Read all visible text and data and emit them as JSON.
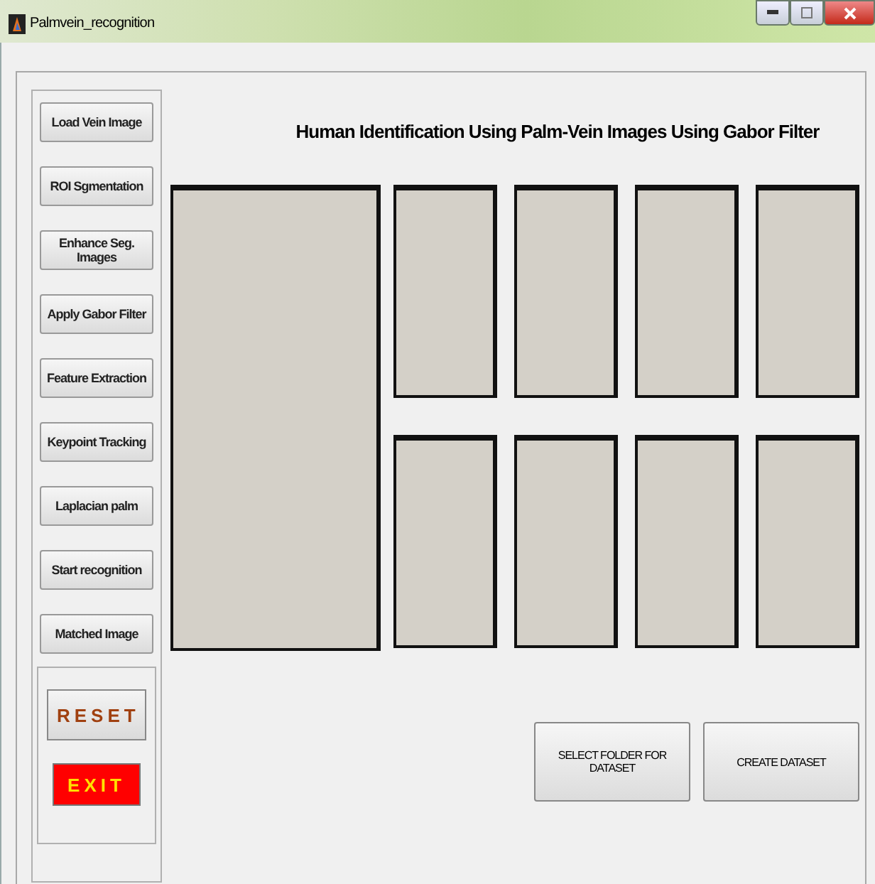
{
  "window": {
    "title": "Palmvein_recognition"
  },
  "heading": "Human Identification Using Palm-Vein Images Using Gabor Filter",
  "side_buttons": [
    {
      "label": "Load Vein Image",
      "kind": "normal"
    },
    {
      "label": "ROI Sgmentation",
      "kind": "normal"
    },
    {
      "label": "Enhance Seg. Images",
      "kind": "normal"
    },
    {
      "label": "Apply Gabor Filter",
      "kind": "normal"
    },
    {
      "label": "Feature Extraction",
      "kind": "normal"
    },
    {
      "label": "Keypoint Tracking",
      "kind": "normal"
    },
    {
      "label": "Laplacian palm",
      "kind": "normal"
    },
    {
      "label": "Start recognition",
      "kind": "normal"
    },
    {
      "label": "Matched Image",
      "kind": "normal"
    },
    {
      "label": "RESET",
      "kind": "reset"
    },
    {
      "label": "EXIT",
      "kind": "exit"
    }
  ],
  "dataset_buttons": [
    "SELECT FOLDER FOR DATASET",
    "CREATE DATASET"
  ]
}
